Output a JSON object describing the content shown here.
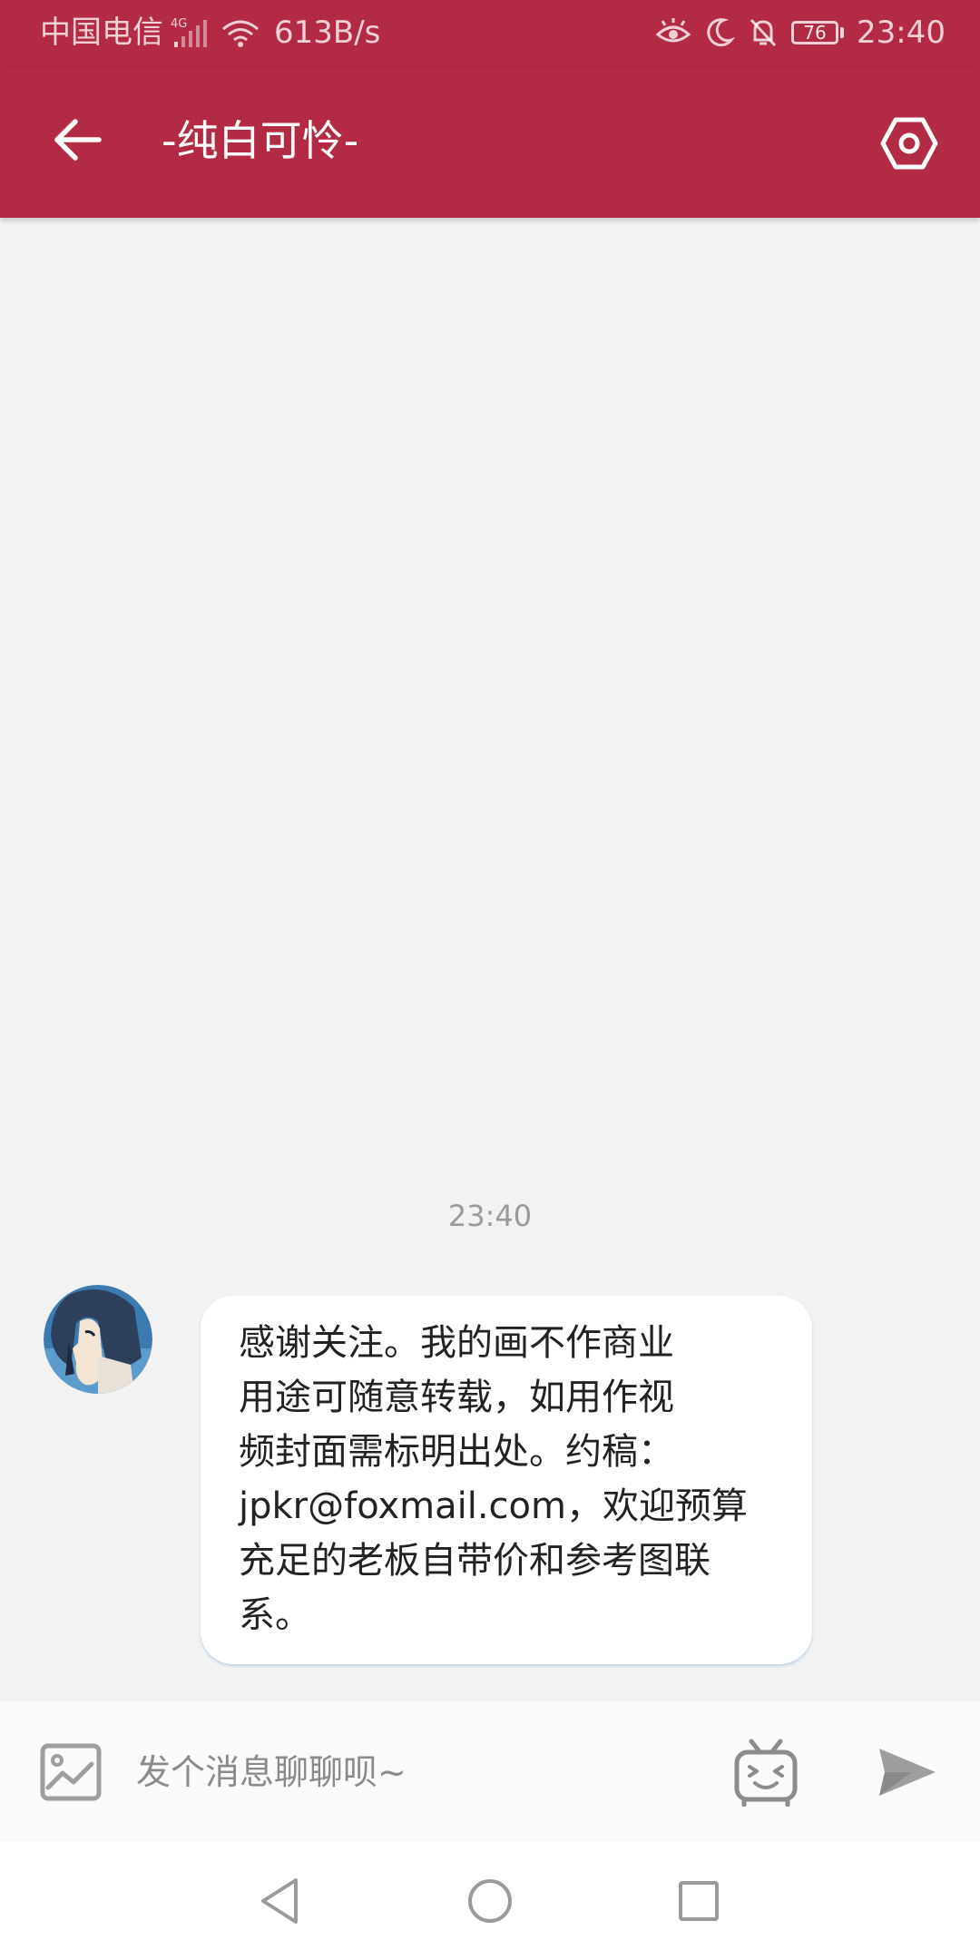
{
  "status_bar": {
    "carrier": "中国电信",
    "network_type": "4G",
    "speed": "613B/s",
    "battery": "76",
    "time": "23:40"
  },
  "app_bar": {
    "back_icon": "arrow-left-icon",
    "title": "-纯白可怜-",
    "settings_icon": "hexagon-settings-icon"
  },
  "chat": {
    "timestamp": "23:40",
    "messages": [
      {
        "sender": "other",
        "avatar": "anime-character-avatar",
        "lines": [
          "感谢关注。我的画不作商业",
          "用途可随意转载，如用作视",
          "频封面需标明出处。约稿：",
          "jpkr@foxmail.com，欢迎预算",
          "充足的老板自带价和参考图联",
          "系。"
        ]
      }
    ]
  },
  "input_bar": {
    "image_icon": "image-icon",
    "placeholder": "发个消息聊聊呗~",
    "value": "",
    "emoji_icon": "emoji-tv-icon",
    "send_icon": "send-icon"
  },
  "nav_bar": {
    "back_icon": "triangle-back-icon",
    "home_icon": "circle-home-icon",
    "recents_icon": "square-recents-icon"
  },
  "colors": {
    "primary": "#b22a44",
    "background": "#f2f2f2",
    "bubble": "#ffffff",
    "icon_gray": "#9e9e9e"
  }
}
